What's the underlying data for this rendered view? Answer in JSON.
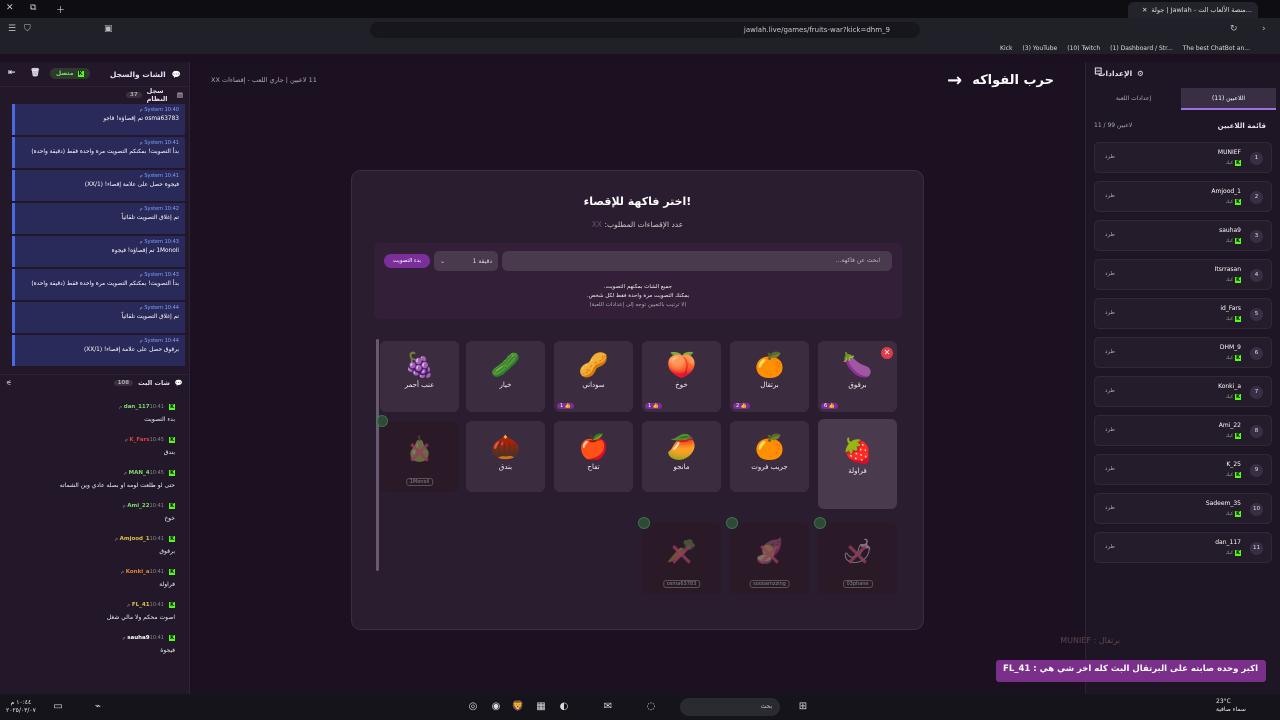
{
  "browser": {
    "tab_title": "جولة | Jawlah - منصة الألعاب الت...",
    "url": "jawlah.live/games/fruits-war?kick=dhm_9",
    "bookmarks": [
      "The best ChatBot an...",
      "(1) Dashboard / Str...",
      "(10) Twitch",
      "(3) YouTube",
      "Kick"
    ]
  },
  "left_panel": {
    "title": "الشات والسجل",
    "status": "متصل",
    "system_log": {
      "title": "سجل النظام",
      "count": "37",
      "messages": [
        {
          "who": "System",
          "time": "10:40 م",
          "text": "osma63783 تم إقصاؤه! قاجو"
        },
        {
          "who": "System",
          "time": "10:41 م",
          "text": "بدأ التصويت! بمكنكم التصويت مرة واحدة فقط (دقيقة واحدة)"
        },
        {
          "who": "System",
          "time": "10:41 م",
          "text": "فيجوة حصل على علامة إقصاء! (XX/1)"
        },
        {
          "who": "System",
          "time": "10:42 م",
          "text": "تم إغلاق التصويت تلقائياً"
        },
        {
          "who": "System",
          "time": "10:43 م",
          "text": "1Monoli تم إقصاؤه! فيجوة"
        },
        {
          "who": "System",
          "time": "10:43 م",
          "text": "بدأ التصويت! بمكنكم التصويت مرة واحدة فقط (دقيقة واحدة)"
        },
        {
          "who": "System",
          "time": "10:44 م",
          "text": "تم إغلاق التصويت تلقائياً"
        },
        {
          "who": "System",
          "time": "10:44 م",
          "text": "برقوق حصل على علامة إقصاء! (XX/1)"
        }
      ]
    },
    "stream_chat": {
      "title": "شات البث",
      "count": "108",
      "messages": [
        {
          "name": "dan_117",
          "color": "#7fdc6a",
          "time": "10:41 م",
          "text": "بدء التصويت"
        },
        {
          "name": "K_Fars",
          "color": "#e04040",
          "time": "10:45 م",
          "text": "بندق"
        },
        {
          "name": "MAN_4",
          "color": "#7fdc6a",
          "time": "10:45 م",
          "text": "حتى لو طلعت لومه او بصله عادي وين الشماته"
        },
        {
          "name": "Ami_22",
          "color": "#7fdc6a",
          "time": "10:41 م",
          "text": "خوخ"
        },
        {
          "name": "Amjood_1",
          "color": "#e0c040",
          "time": "10:41 م",
          "text": "برقوق"
        },
        {
          "name": "Konki_a",
          "color": "#e08a30",
          "time": "10:41 م",
          "text": "فراولة"
        },
        {
          "name": "FL_41",
          "color": "#e0c040",
          "time": "10:41 م",
          "text": "اصوت محكم ولا مالي شغل"
        },
        {
          "name": "sauha9",
          "color": "#fff",
          "time": "10:41 م",
          "text": "فيجوة"
        }
      ]
    }
  },
  "main": {
    "top_info": "11 لاعبين | جاري اللعب - إقصاءات XX",
    "game_title": "حرب الفواكه",
    "card_title": "اختر فاكهة للإقصاء!",
    "required_label": "عدد الإقصاءات المطلوب:",
    "required_value": "XX",
    "search_placeholder": "ابحث عن فاكهة...",
    "duration": "1 دقيقة",
    "start_vote": "بدء التصويت",
    "note1": "جميع الشات بمكنهم التصويت.",
    "note2": "بمكنك التصويت مرة واحدة فقط لكل شخص.",
    "note3": "(لا ترتيب بالتعيين توجه إلى إعدادات اللعبة)",
    "fruits_row1": [
      {
        "name": "برقوق",
        "icon": "🍆",
        "votes": "6"
      },
      {
        "name": "برتقال",
        "icon": "🍊",
        "votes": "2"
      },
      {
        "name": "خوخ",
        "icon": "🍑",
        "votes": "1"
      },
      {
        "name": "سوداني",
        "icon": "🥜",
        "votes": "1"
      },
      {
        "name": "خيار",
        "icon": "🥒",
        "votes": ""
      },
      {
        "name": "عنب أحمر",
        "icon": "🍇",
        "votes": ""
      }
    ],
    "fruits_row2": [
      {
        "name": "فراولة",
        "icon": "🍓"
      },
      {
        "name": "جريب فروت",
        "icon": "🍊"
      },
      {
        "name": "مانجو",
        "icon": "🥭"
      },
      {
        "name": "تفاح",
        "icon": "🍎"
      },
      {
        "name": "بندق",
        "icon": "🌰"
      }
    ],
    "eliminated": [
      {
        "icon": "🍐",
        "by": "1Monoli"
      },
      {
        "icon": "🥕",
        "by": "osma63783"
      },
      {
        "icon": "🍠",
        "by": "soooamzzing"
      },
      {
        "icon": "🌶",
        "by": "03phane"
      }
    ]
  },
  "right_panel": {
    "title": "الإعدادات",
    "tab_players": "اللاعبين (11)",
    "tab_settings": "إعدادات اللعبة",
    "list_title": "قائمة اللاعبين",
    "list_count": "11 / 99 لاعبين",
    "kick_label": "طرد",
    "players": [
      {
        "n": "1",
        "name": "MUNIEF",
        "sub": "كيك"
      },
      {
        "n": "2",
        "name": "Amjood_1",
        "sub": "كيك"
      },
      {
        "n": "3",
        "name": "sauha9",
        "sub": "كيك"
      },
      {
        "n": "4",
        "name": "Itsrrasan",
        "sub": "كيك"
      },
      {
        "n": "5",
        "name": "id_Fars",
        "sub": "كيك"
      },
      {
        "n": "6",
        "name": "DHM_9",
        "sub": "كيك"
      },
      {
        "n": "7",
        "name": "Konki_a",
        "sub": "كيك"
      },
      {
        "n": "8",
        "name": "Ami_22",
        "sub": "كيك"
      },
      {
        "n": "9",
        "name": "K_25",
        "sub": "كيك"
      },
      {
        "n": "10",
        "name": "Sadeem_35",
        "sub": "كيك"
      },
      {
        "n": "11",
        "name": "dan_117",
        "sub": "كيك"
      }
    ]
  },
  "overlay": {
    "faded_line": "برتقال : MUNIEF",
    "banner": "اكبر وحده صابته على البرتقال البث كله اخر شي هي : FL_41"
  },
  "taskbar": {
    "search": "بحث",
    "time": "١٠:٤٤ م",
    "date": "٢٠٢٥/٠٣/٠٧",
    "weather_temp": "23°C",
    "weather_desc": "سماء صافية"
  }
}
